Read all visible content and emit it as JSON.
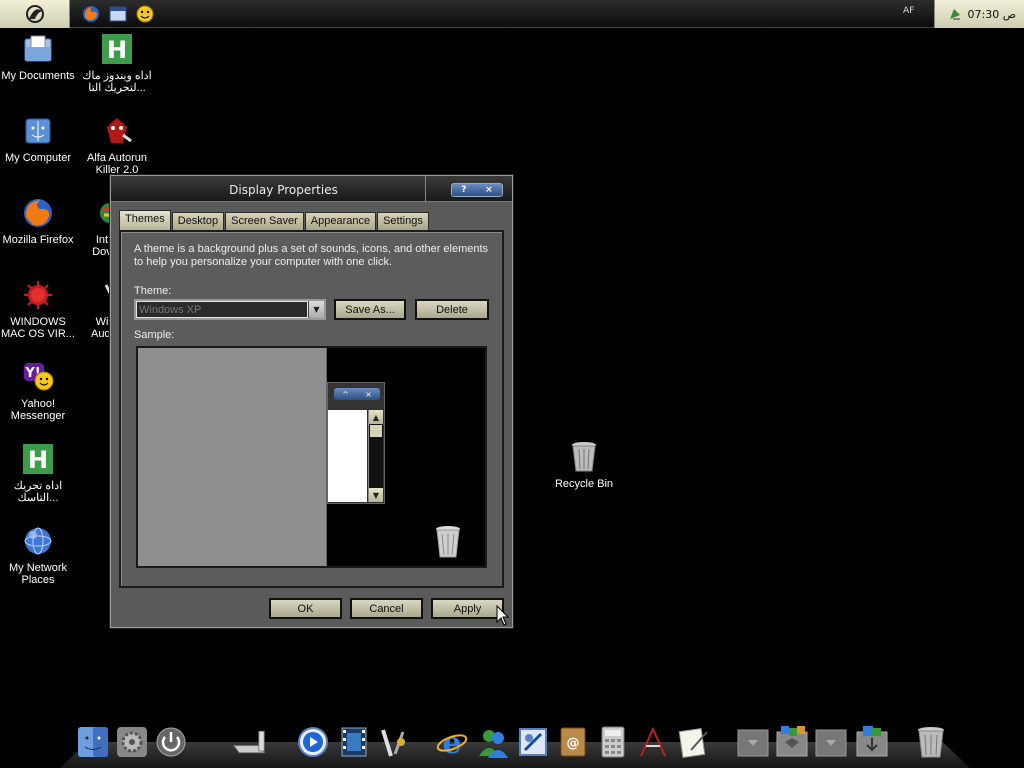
{
  "topbar": {
    "quicklaunch": [
      "firefox-icon",
      "window-icon",
      "smiley-icon"
    ],
    "tray_text": "AF",
    "clock": "ص 07:30"
  },
  "desktop_icons": [
    {
      "label": "My Documents",
      "icon": "folder-icon"
    },
    {
      "label": "اداه ويندوز ماك\nلتحريك التا...",
      "icon": "h-app-icon"
    },
    {
      "label": "My Computer",
      "icon": "computer-icon"
    },
    {
      "label": "Alfa Autorun\nKiller 2.0",
      "icon": "alfa-autorun-icon"
    },
    {
      "label": "Mozilla Firefox",
      "icon": "firefox-icon"
    },
    {
      "label": "Int\nDov",
      "icon": "internet-download-icon"
    },
    {
      "label": "WINDOWS\nMAC OS VIR...",
      "icon": "virus-icon"
    },
    {
      "label": "Wi\nAudi",
      "icon": "audio-icon"
    },
    {
      "label": "Yahoo!\nMessenger",
      "icon": "yahoo-icon"
    },
    {
      "label": "اداه تحريك\nالتاسك...",
      "icon": "h-app-icon"
    },
    {
      "label": "My Network\nPlaces",
      "icon": "network-icon"
    }
  ],
  "dialog": {
    "title": "Display Properties",
    "help_glyph": "?",
    "close_glyph": "×",
    "tabs": [
      "Themes",
      "Desktop",
      "Screen Saver",
      "Appearance",
      "Settings"
    ],
    "active_tab": "Themes",
    "description": "A theme is a background plus a set of sounds, icons, and other elements to help you personalize your computer with one click.",
    "theme_label": "Theme:",
    "theme_value": "Windows XP",
    "save_as": "Save As...",
    "delete": "Delete",
    "sample_label": "Sample:",
    "ok": "OK",
    "cancel": "Cancel",
    "apply": "Apply"
  },
  "recycle_bin": {
    "label": "Recycle Bin"
  },
  "dock": [
    "finder-icon",
    "system-preferences-icon",
    "shutdown-icon",
    "drive-icon",
    "quicktime-icon",
    "media-icon",
    "tools-icon",
    "internet-explorer-icon",
    "msn-icon",
    "mail-icon",
    "address-book-icon",
    "calculator-icon",
    "textedit-icon",
    "notes-icon",
    "stack-icon",
    "applications-stack-icon",
    "stack-icon",
    "downloads-stack-icon",
    "trash-icon"
  ],
  "colors": {
    "dialog_bg": "#5a5a5a",
    "button_face": "#c8c6ad",
    "title_buttons": "#3d66a8"
  }
}
